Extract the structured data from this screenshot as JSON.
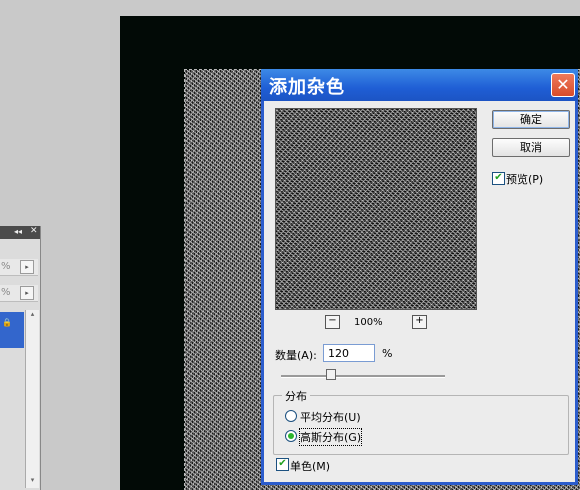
{
  "dialog": {
    "title": "添加杂色",
    "close_symbol": "✕",
    "ok_label": "确定",
    "cancel_label": "取消",
    "preview_label": "预览(P)",
    "preview_checked": true,
    "zoom_out": "−",
    "zoom_in": "+",
    "zoom_level": "100%",
    "amount_label": "数量(A):",
    "amount_value": "120",
    "amount_unit": "%",
    "distribution_title": "分布",
    "uniform_label": "平均分布(U)",
    "gaussian_label": "高斯分布(G)",
    "distribution_selected": "gaussian",
    "mono_label": "单色(M)",
    "mono_checked": true,
    "check_mark": "✔"
  },
  "side_panel": {
    "collapse_icon": "◂◂",
    "close_icon": "✕",
    "row1_value": "%",
    "row2_value": "%",
    "arrow": "▸",
    "lock_icon": "🔒",
    "scroll_up": "▴",
    "scroll_down": "▾"
  },
  "colors": {
    "titlebar": "#1f5ed5",
    "close_button": "#d74c2a",
    "check_color": "#21a121",
    "layer_selected": "#3366cc"
  }
}
